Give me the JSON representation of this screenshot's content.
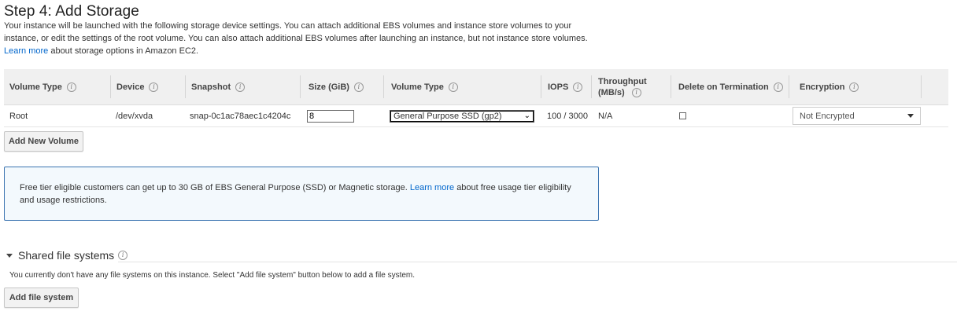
{
  "page": {
    "title": "Step 4: Add Storage",
    "intro_before_link": "Your instance will be launched with the following storage device settings. You can attach additional EBS volumes and instance store volumes to your instance, or edit the settings of the root volume. You can also attach additional EBS volumes after launching an instance, but not instance store volumes.",
    "intro_link": "Learn more",
    "intro_after_link": "about storage options in Amazon EC2."
  },
  "table": {
    "headers": {
      "volume_type": "Volume Type",
      "device": "Device",
      "snapshot": "Snapshot",
      "size": "Size (GiB)",
      "volume_type_2": "Volume Type",
      "iops": "IOPS",
      "throughput_1": "Throughput",
      "throughput_2": "(MB/s)",
      "delete_on_termination": "Delete on Termination",
      "encryption": "Encryption"
    },
    "row": {
      "volume_type": "Root",
      "device": "/dev/xvda",
      "snapshot": "snap-0c1ac78aec1c4204c",
      "size": "8",
      "ebs_volume_type": "General Purpose SSD (gp2)",
      "iops": "100 / 3000",
      "throughput": "N/A",
      "delete_on_termination": false,
      "encryption": "Not Encrypted"
    }
  },
  "buttons": {
    "add_new_volume": "Add New Volume",
    "add_file_system": "Add file system"
  },
  "notice": {
    "text_before_link": "Free tier eligible customers can get up to 30 GB of EBS General Purpose (SSD) or Magnetic storage.",
    "link": "Learn more",
    "text_after_link": "about free usage tier eligibility and usage restrictions."
  },
  "shared_fs": {
    "title": "Shared file systems",
    "description": "You currently don't have any file systems on this instance. Select \"Add file system\" button below to add a file system."
  },
  "colors": {
    "link": "#0066cc",
    "notice_border": "#3a73b0",
    "notice_bg": "#f3f9fd",
    "header_bg": "#f0f0f0"
  }
}
